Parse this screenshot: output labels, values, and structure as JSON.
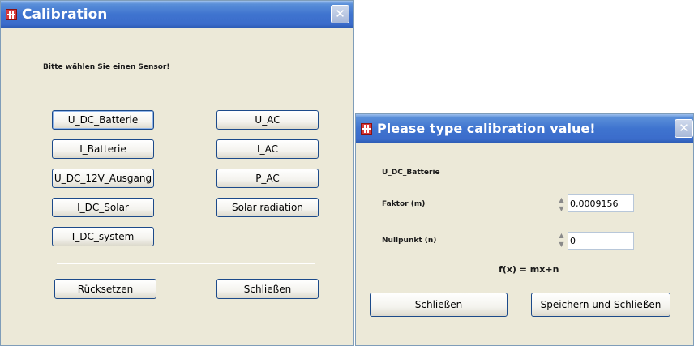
{
  "calibration_window": {
    "title": "Calibration",
    "close_glyph": "✕",
    "prompt": "Bitte wählen Sie einen Sensor!",
    "sensors": [
      "U_DC_Batterie",
      "U_AC",
      "I_Batterie",
      "I_AC",
      "U_DC_12V_Ausgang",
      "P_AC",
      "I_DC_Solar",
      "Solar radiation",
      "I_DC_system"
    ],
    "reset_label": "Rücksetzen",
    "close_label": "Schließen"
  },
  "value_dialog": {
    "title": "Please type calibration value!",
    "close_glyph": "✕",
    "sensor_name": "U_DC_Batterie",
    "factor_label": "Faktor (m)",
    "factor_value": "0,0009156",
    "offset_label": "Nullpunkt (n)",
    "offset_value": "0",
    "formula": "f(x) = mx+n",
    "close_label": "Schließen",
    "save_close_label": "Speichern und Schließen"
  },
  "icons": {
    "app": "app-icon",
    "spin_up": "▲",
    "spin_down": "▼"
  }
}
